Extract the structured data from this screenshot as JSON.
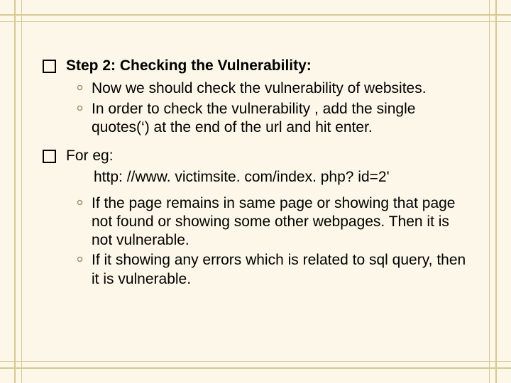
{
  "heading": "Step 2: Checking the Vulnerability:",
  "sub1a": "Now we should check the vulnerability of websites.",
  "sub1b": "In order to check the vulnerability , add the single quotes(‘) at the end of the url and hit enter.",
  "for_eg_label": "For eg:",
  "url_line": "http: //www. victimsite. com/index. php? id=2'",
  "sub2a": " If the page remains in same page or showing that page not found or showing some other webpages. Then it is not vulnerable.",
  "sub2b": "If it showing any errors which is related to sql query, then it is vulnerable."
}
